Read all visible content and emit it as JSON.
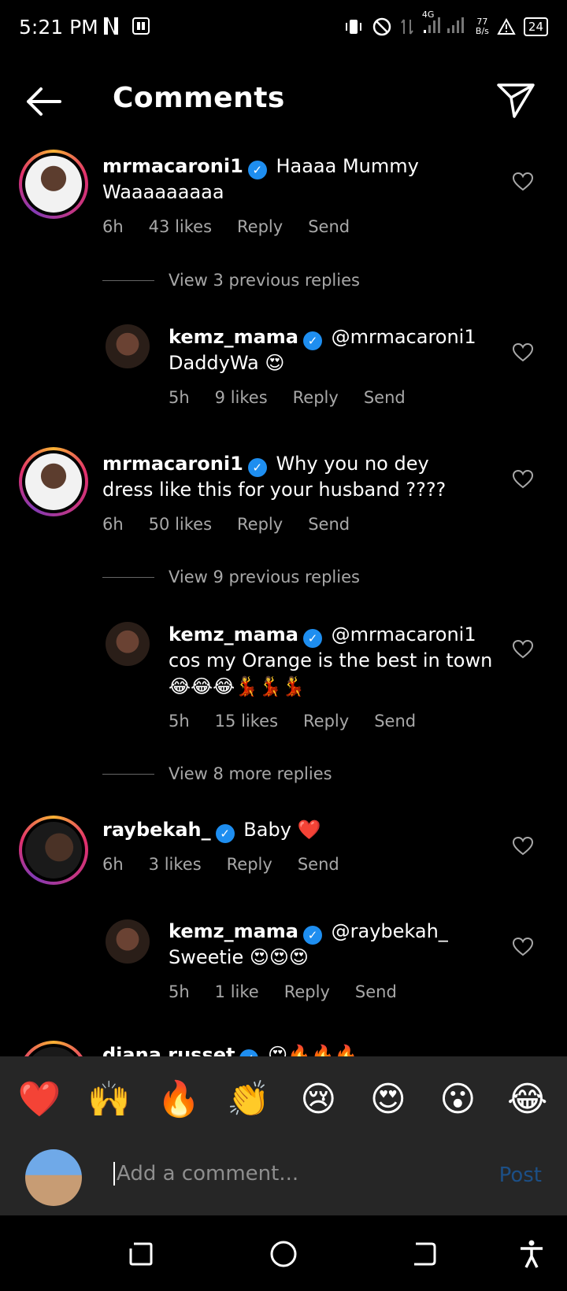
{
  "status_bar": {
    "time": "5:21 PM",
    "network": "4G",
    "speed_value": "77",
    "speed_unit": "B/s",
    "battery": "24"
  },
  "header": {
    "title": "Comments"
  },
  "comments": [
    {
      "username": "mrmacaroni1",
      "text": "Haaaa Mummy Waaaaaaaaa",
      "time": "6h",
      "likes": "43 likes",
      "reply": "Reply",
      "send": "Send"
    },
    {
      "username": "mrmacaroni1",
      "text": "Why you no dey dress like this for your husband ????",
      "time": "6h",
      "likes": "50 likes",
      "reply": "Reply",
      "send": "Send"
    },
    {
      "username": "raybekah_",
      "text": "Baby ❤️",
      "time": "6h",
      "likes": "3 likes",
      "reply": "Reply",
      "send": "Send"
    },
    {
      "username": "diana russet",
      "text": "😍🔥🔥🔥"
    }
  ],
  "replies": [
    {
      "username": "kemz_mama",
      "text": "@mrmacaroni1 DaddyWa 😍",
      "time": "5h",
      "likes": "9 likes",
      "reply": "Reply",
      "send": "Send"
    },
    {
      "username": "kemz_mama",
      "text": "@mrmacaroni1 cos my Orange is the best in town 😂😂😂💃💃💃",
      "time": "5h",
      "likes": "15 likes",
      "reply": "Reply",
      "send": "Send"
    },
    {
      "username": "kemz_mama",
      "text": "@raybekah_ Sweetie 😍😍😍",
      "time": "5h",
      "likes": "1 like",
      "reply": "Reply",
      "send": "Send"
    }
  ],
  "view_replies": [
    "View 3 previous replies",
    "View 9 previous replies",
    "View 8 more replies"
  ],
  "emoji_bar": [
    "❤️",
    "🙌",
    "🔥",
    "👏",
    "😢",
    "😍",
    "😮",
    "😂"
  ],
  "composer": {
    "placeholder": "Add a comment...",
    "post_label": "Post"
  },
  "colors": {
    "background": "#000000",
    "panel": "#262626",
    "verified": "#1e8ef0",
    "meta_text": "#a8a8a8",
    "post_disabled": "#1c4f86"
  }
}
